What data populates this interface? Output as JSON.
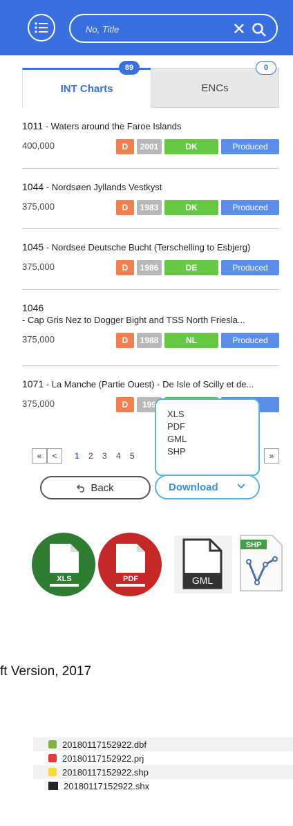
{
  "header": {
    "search_placeholder": "No, Title"
  },
  "tabs": [
    {
      "label": "INT Charts",
      "count": "89"
    },
    {
      "label": "ENCs",
      "count": "0"
    }
  ],
  "charts": [
    {
      "number": "1011",
      "title": " - Waters around the Faroe Islands",
      "scale": "400,000",
      "edition": "D",
      "year": "2001",
      "country": "DK",
      "status": "Produced"
    },
    {
      "number": "1044",
      "title": " - Nordsøen Jyllands Vestkyst",
      "scale": "375,000",
      "edition": "D",
      "year": "1983",
      "country": "DK",
      "status": "Produced"
    },
    {
      "number": "1045",
      "title": " - Nordsee Deutsche Bucht (Terschelling to Esbjerg)",
      "scale": "375,000",
      "edition": "D",
      "year": "1986",
      "country": "DE",
      "status": "Produced"
    },
    {
      "number": "1046",
      "title": "- Cap Gris Nez to Dogger Bight and TSS North Friesla...",
      "scale": "375,000",
      "edition": "D",
      "year": "1988",
      "country": "NL",
      "status": "Produced"
    },
    {
      "number": "1071",
      "title": " - La Manche (Partie Ouest) - De Isle of Scilly et de...",
      "scale": "375,000",
      "edition": "D",
      "year": "199",
      "country": "",
      "status": "ed"
    }
  ],
  "pagination": {
    "first": "«",
    "prev": "<",
    "pages": [
      "1",
      "2",
      "3",
      "4",
      "5"
    ],
    "current": "1",
    "last": "»"
  },
  "download_menu": {
    "options": [
      "XLS",
      "PDF",
      "GML",
      "SHP"
    ]
  },
  "buttons": {
    "back": "Back",
    "download": "Download"
  },
  "file_icons": [
    "XLS",
    "PDF",
    "GML",
    "SHP"
  ],
  "caption": "ft Version, 2017",
  "files": [
    "20180117152922.dbf",
    "20180117152922.prj",
    "20180117152922.shp",
    "20180117152922.shx"
  ],
  "colors": {
    "header": "#3a6fe0",
    "edition": "#f08050",
    "year": "#b8b8b8",
    "country": "#66c844",
    "status": "#5a8ee8",
    "xls": "#2e7d32",
    "pdf": "#c62828"
  }
}
